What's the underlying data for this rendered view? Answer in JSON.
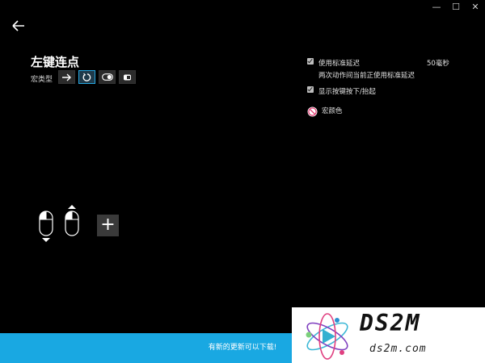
{
  "window": {
    "controls": {
      "minimize": "—",
      "maximize": "☐",
      "close": "✕"
    }
  },
  "header": {
    "back_icon": "arrow-left-icon",
    "title": "左键连点"
  },
  "macro_type": {
    "label": "宏类型",
    "options": [
      {
        "icon": "arrow-right-icon",
        "selected": false
      },
      {
        "icon": "repeat-icon",
        "selected": true
      },
      {
        "icon": "toggle-icon",
        "selected": false
      },
      {
        "icon": "hold-icon",
        "selected": false
      }
    ]
  },
  "settings": {
    "use_standard_delay": {
      "label": "使用标准延迟",
      "checked": true,
      "value": "50毫秒"
    },
    "delay_note": "两次动作间当前正使用标准延迟",
    "show_key_press": {
      "label": "显示按键按下/抬起",
      "checked": true
    },
    "macro_color": {
      "label": "宏颜色",
      "icon": "no-color-icon"
    }
  },
  "sequence": {
    "steps": [
      {
        "icon": "mouse-left-press-icon",
        "direction": "down"
      },
      {
        "icon": "mouse-left-release-icon",
        "direction": "up"
      }
    ],
    "add_label": "+"
  },
  "banner": {
    "text": "有新的更新可以下载!"
  },
  "watermark": {
    "brand": "DS2M",
    "url": "ds2m.com"
  },
  "colors": {
    "accent": "#19a8e2",
    "background": "#000000"
  }
}
